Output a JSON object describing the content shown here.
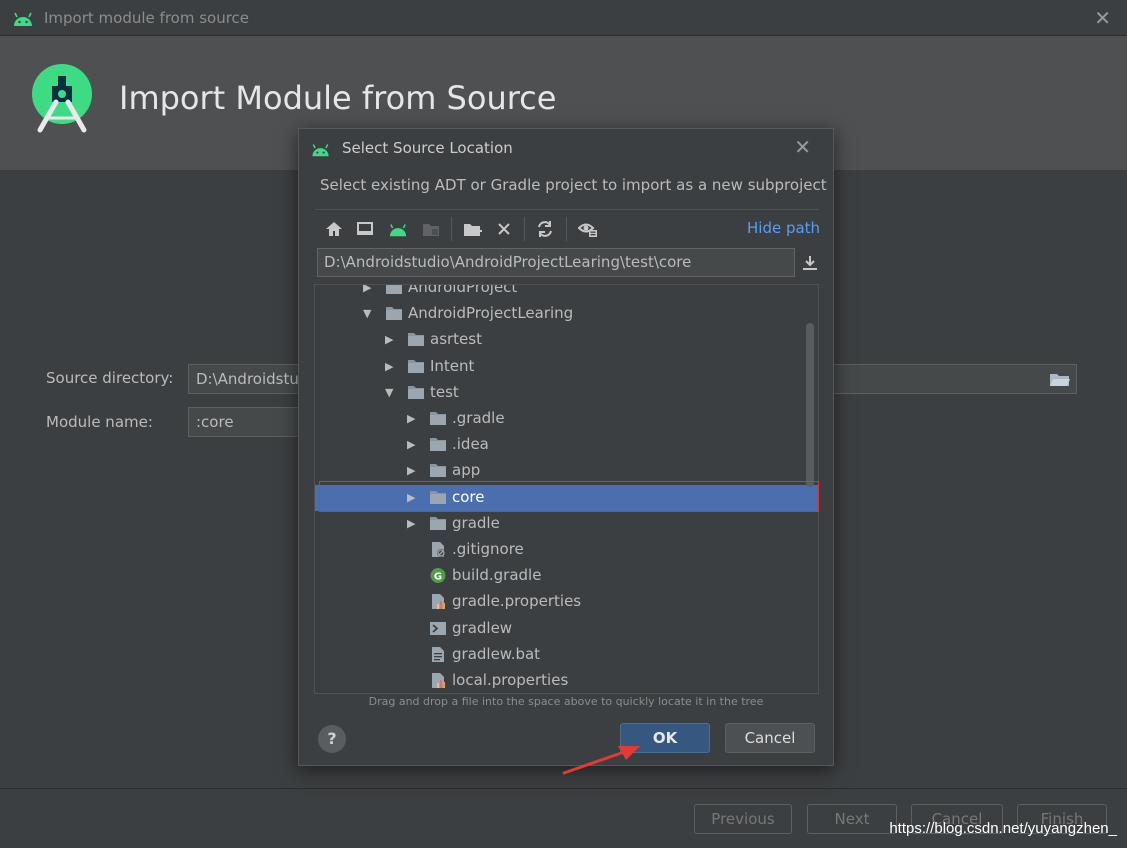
{
  "window": {
    "title": "Import module from source",
    "close_glyph": "✕"
  },
  "banner": {
    "title": "Import Module from Source"
  },
  "form": {
    "source_label": "Source directory:",
    "source_value": "D:\\Androidstu",
    "module_label": "Module name:",
    "module_value": ":core"
  },
  "footer": {
    "previous": "Previous",
    "next": "Next",
    "cancel": "Cancel",
    "finish": "Finish",
    "watermark": "https://blog.csdn.net/yuyangzhen_"
  },
  "dialog": {
    "title": "Select Source Location",
    "close_glyph": "✕",
    "subtitle": "Select existing ADT or Gradle project to import as a new subproject",
    "hide_path": "Hide path",
    "path": "D:\\Androidstudio\\AndroidProjectLearing\\test\\core",
    "tree": [
      {
        "label": "AndroidProject",
        "type": "folder",
        "level": 0,
        "expanded": false
      },
      {
        "label": "AndroidProjectLearing",
        "type": "folder",
        "level": 0,
        "expanded": true
      },
      {
        "label": "asrtest",
        "type": "folder",
        "level": 1,
        "expanded": false
      },
      {
        "label": "Intent",
        "type": "folder",
        "level": 1,
        "expanded": false
      },
      {
        "label": "test",
        "type": "folder",
        "level": 1,
        "expanded": true
      },
      {
        "label": ".gradle",
        "type": "folder",
        "level": 2,
        "expanded": false
      },
      {
        "label": ".idea",
        "type": "folder",
        "level": 2,
        "expanded": false
      },
      {
        "label": "app",
        "type": "folder",
        "level": 2,
        "expanded": false
      },
      {
        "label": "core",
        "type": "folder",
        "level": 2,
        "expanded": false,
        "selected": true
      },
      {
        "label": "gradle",
        "type": "folder",
        "level": 2,
        "expanded": false
      },
      {
        "label": ".gitignore",
        "type": "gitignore",
        "level": 2
      },
      {
        "label": "build.gradle",
        "type": "gradle-file",
        "level": 2
      },
      {
        "label": "gradle.properties",
        "type": "properties-file",
        "level": 2
      },
      {
        "label": "gradlew",
        "type": "shell-file",
        "level": 2
      },
      {
        "label": "gradlew.bat",
        "type": "text-file",
        "level": 2
      },
      {
        "label": "local.properties",
        "type": "properties-file",
        "level": 2
      }
    ],
    "hint": "Drag and drop a file into the space above to quickly locate it in the tree",
    "help": "?",
    "ok": "OK",
    "cancel": "Cancel"
  },
  "colors": {
    "accent_link": "#589df6",
    "android_green": "#3ddc84",
    "selection": "#4b6eaf",
    "ok_button": "#365880",
    "highlight_box": "#dd3333"
  }
}
